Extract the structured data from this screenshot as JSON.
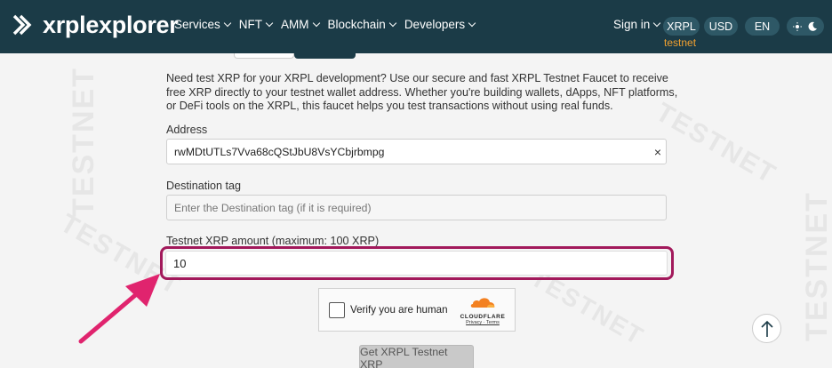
{
  "header": {
    "logo_text": "xrplexplorer",
    "nav": [
      {
        "label": "Services"
      },
      {
        "label": "NFT"
      },
      {
        "label": "AMM"
      },
      {
        "label": "Blockchain"
      },
      {
        "label": "Developers"
      }
    ],
    "signin": "Sign in",
    "network_button": "XRPL",
    "currency_button": "USD",
    "language_button": "EN",
    "network_name": "testnet",
    "theme_icons": [
      "sun-icon",
      "moon-icon"
    ]
  },
  "watermark": "TESTNET",
  "faucet": {
    "intro": "Need test XRP for your XRPL development? Use our secure and fast XRPL Testnet Faucet to receive free XRP directly to your testnet wallet address. Whether you're building wallets, dApps, NFT platforms, or DeFi tools on the XRPL, this faucet helps you test transactions without using real funds.",
    "address_label": "Address",
    "address_value": "rwMDtUTLs7Vva68cQStJbU8VsYCbjrbmpg",
    "clear_icon": "×",
    "destination_label": "Destination tag",
    "destination_placeholder": "Enter the Destination tag (if it is required)",
    "amount_label": "Testnet XRP amount (maximum: 100 XRP)",
    "amount_value": "10",
    "captcha_label": "Verify you are human",
    "captcha_brand": "CLOUDFLARE",
    "captcha_links": "Privacy · Terms",
    "submit_label": "Get XRPL Testnet XRP"
  },
  "colors": {
    "header_bg": "#1b3b47",
    "highlight": "#a2195b",
    "arrow": "#e0246e",
    "network_text": "#f0a030"
  }
}
